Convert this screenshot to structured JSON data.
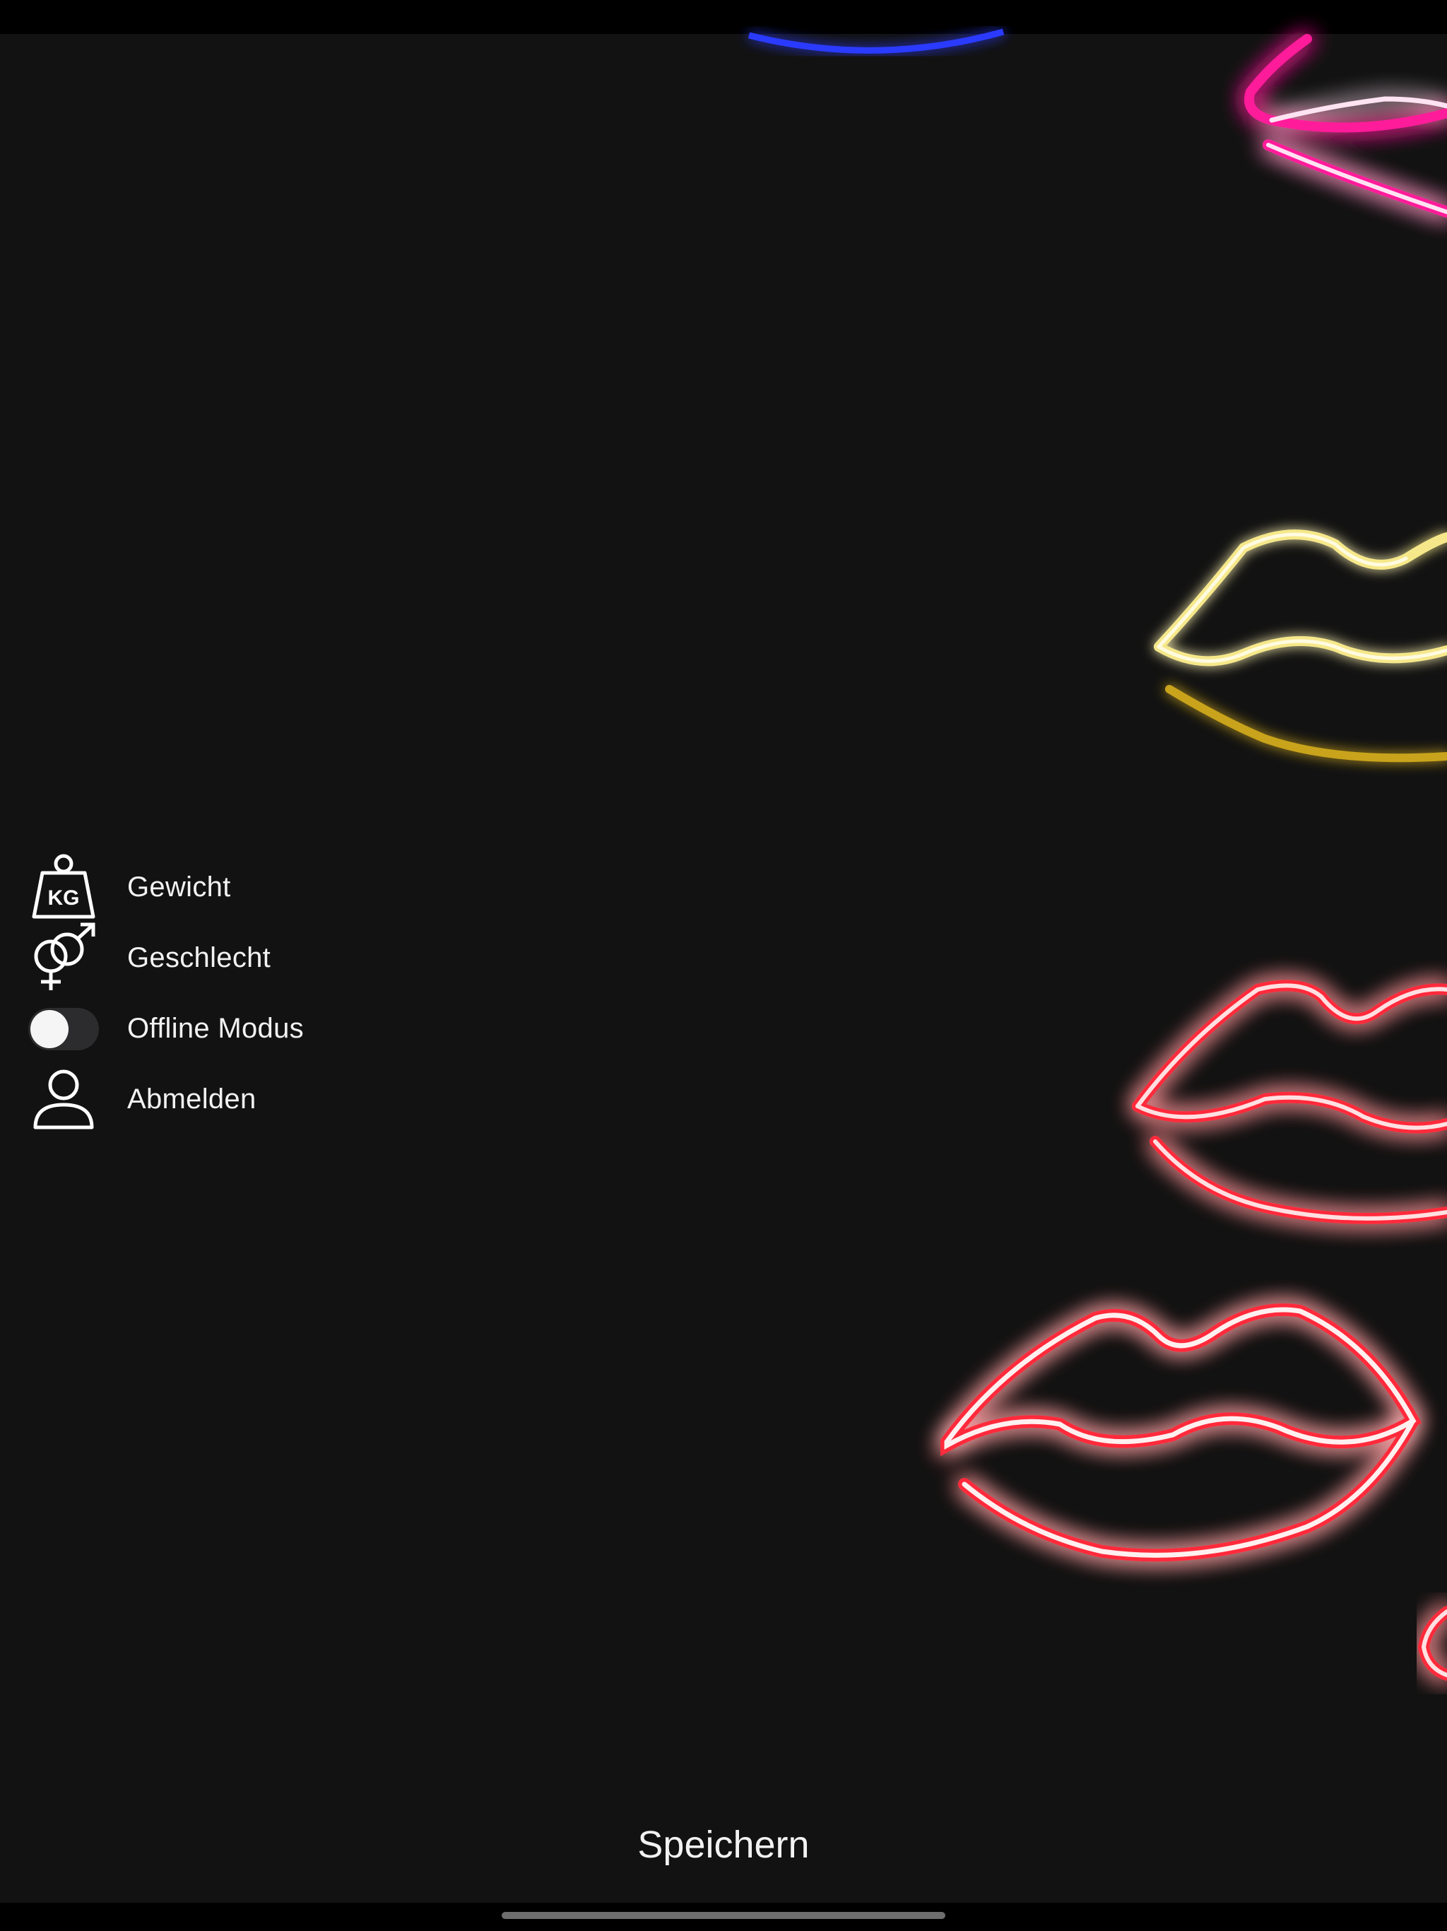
{
  "menu": {
    "items": [
      {
        "id": "weight",
        "label": "Gewicht",
        "icon": "weight-kg-icon",
        "icon_text": "KG"
      },
      {
        "id": "gender",
        "label": "Geschlecht",
        "icon": "gender-icon"
      },
      {
        "id": "offline",
        "label": "Offline Modus",
        "icon": "toggle-switch",
        "toggle_on": false
      },
      {
        "id": "logout",
        "label": "Abmelden",
        "icon": "user-icon"
      }
    ]
  },
  "footer": {
    "save_label": "Speichern"
  },
  "background": {
    "image": "neon-lips",
    "colors": {
      "blue": "#2b3bff",
      "pink": "#ff1a9a",
      "yellow": "#f6e88a",
      "red": "#ff2a3a"
    }
  }
}
